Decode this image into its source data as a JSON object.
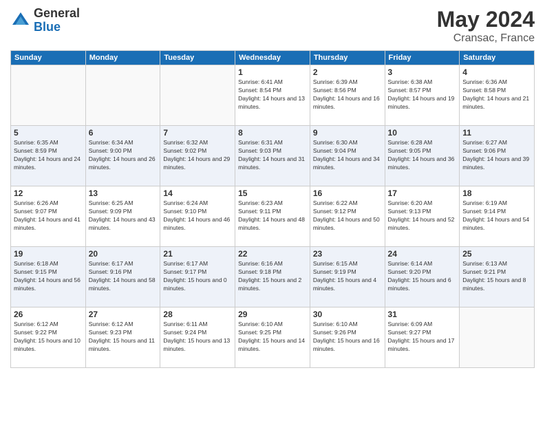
{
  "header": {
    "logo_general": "General",
    "logo_blue": "Blue",
    "month_year": "May 2024",
    "location": "Cransac, France"
  },
  "days_of_week": [
    "Sunday",
    "Monday",
    "Tuesday",
    "Wednesday",
    "Thursday",
    "Friday",
    "Saturday"
  ],
  "weeks": [
    [
      {
        "day": "",
        "sunrise": "",
        "sunset": "",
        "daylight": ""
      },
      {
        "day": "",
        "sunrise": "",
        "sunset": "",
        "daylight": ""
      },
      {
        "day": "",
        "sunrise": "",
        "sunset": "",
        "daylight": ""
      },
      {
        "day": "1",
        "sunrise": "6:41 AM",
        "sunset": "8:54 PM",
        "daylight": "14 hours and 13 minutes."
      },
      {
        "day": "2",
        "sunrise": "6:39 AM",
        "sunset": "8:56 PM",
        "daylight": "14 hours and 16 minutes."
      },
      {
        "day": "3",
        "sunrise": "6:38 AM",
        "sunset": "8:57 PM",
        "daylight": "14 hours and 19 minutes."
      },
      {
        "day": "4",
        "sunrise": "6:36 AM",
        "sunset": "8:58 PM",
        "daylight": "14 hours and 21 minutes."
      }
    ],
    [
      {
        "day": "5",
        "sunrise": "6:35 AM",
        "sunset": "8:59 PM",
        "daylight": "14 hours and 24 minutes."
      },
      {
        "day": "6",
        "sunrise": "6:34 AM",
        "sunset": "9:00 PM",
        "daylight": "14 hours and 26 minutes."
      },
      {
        "day": "7",
        "sunrise": "6:32 AM",
        "sunset": "9:02 PM",
        "daylight": "14 hours and 29 minutes."
      },
      {
        "day": "8",
        "sunrise": "6:31 AM",
        "sunset": "9:03 PM",
        "daylight": "14 hours and 31 minutes."
      },
      {
        "day": "9",
        "sunrise": "6:30 AM",
        "sunset": "9:04 PM",
        "daylight": "14 hours and 34 minutes."
      },
      {
        "day": "10",
        "sunrise": "6:28 AM",
        "sunset": "9:05 PM",
        "daylight": "14 hours and 36 minutes."
      },
      {
        "day": "11",
        "sunrise": "6:27 AM",
        "sunset": "9:06 PM",
        "daylight": "14 hours and 39 minutes."
      }
    ],
    [
      {
        "day": "12",
        "sunrise": "6:26 AM",
        "sunset": "9:07 PM",
        "daylight": "14 hours and 41 minutes."
      },
      {
        "day": "13",
        "sunrise": "6:25 AM",
        "sunset": "9:09 PM",
        "daylight": "14 hours and 43 minutes."
      },
      {
        "day": "14",
        "sunrise": "6:24 AM",
        "sunset": "9:10 PM",
        "daylight": "14 hours and 46 minutes."
      },
      {
        "day": "15",
        "sunrise": "6:23 AM",
        "sunset": "9:11 PM",
        "daylight": "14 hours and 48 minutes."
      },
      {
        "day": "16",
        "sunrise": "6:22 AM",
        "sunset": "9:12 PM",
        "daylight": "14 hours and 50 minutes."
      },
      {
        "day": "17",
        "sunrise": "6:20 AM",
        "sunset": "9:13 PM",
        "daylight": "14 hours and 52 minutes."
      },
      {
        "day": "18",
        "sunrise": "6:19 AM",
        "sunset": "9:14 PM",
        "daylight": "14 hours and 54 minutes."
      }
    ],
    [
      {
        "day": "19",
        "sunrise": "6:18 AM",
        "sunset": "9:15 PM",
        "daylight": "14 hours and 56 minutes."
      },
      {
        "day": "20",
        "sunrise": "6:17 AM",
        "sunset": "9:16 PM",
        "daylight": "14 hours and 58 minutes."
      },
      {
        "day": "21",
        "sunrise": "6:17 AM",
        "sunset": "9:17 PM",
        "daylight": "15 hours and 0 minutes."
      },
      {
        "day": "22",
        "sunrise": "6:16 AM",
        "sunset": "9:18 PM",
        "daylight": "15 hours and 2 minutes."
      },
      {
        "day": "23",
        "sunrise": "6:15 AM",
        "sunset": "9:19 PM",
        "daylight": "15 hours and 4 minutes."
      },
      {
        "day": "24",
        "sunrise": "6:14 AM",
        "sunset": "9:20 PM",
        "daylight": "15 hours and 6 minutes."
      },
      {
        "day": "25",
        "sunrise": "6:13 AM",
        "sunset": "9:21 PM",
        "daylight": "15 hours and 8 minutes."
      }
    ],
    [
      {
        "day": "26",
        "sunrise": "6:12 AM",
        "sunset": "9:22 PM",
        "daylight": "15 hours and 10 minutes."
      },
      {
        "day": "27",
        "sunrise": "6:12 AM",
        "sunset": "9:23 PM",
        "daylight": "15 hours and 11 minutes."
      },
      {
        "day": "28",
        "sunrise": "6:11 AM",
        "sunset": "9:24 PM",
        "daylight": "15 hours and 13 minutes."
      },
      {
        "day": "29",
        "sunrise": "6:10 AM",
        "sunset": "9:25 PM",
        "daylight": "15 hours and 14 minutes."
      },
      {
        "day": "30",
        "sunrise": "6:10 AM",
        "sunset": "9:26 PM",
        "daylight": "15 hours and 16 minutes."
      },
      {
        "day": "31",
        "sunrise": "6:09 AM",
        "sunset": "9:27 PM",
        "daylight": "15 hours and 17 minutes."
      },
      {
        "day": "",
        "sunrise": "",
        "sunset": "",
        "daylight": ""
      }
    ]
  ]
}
